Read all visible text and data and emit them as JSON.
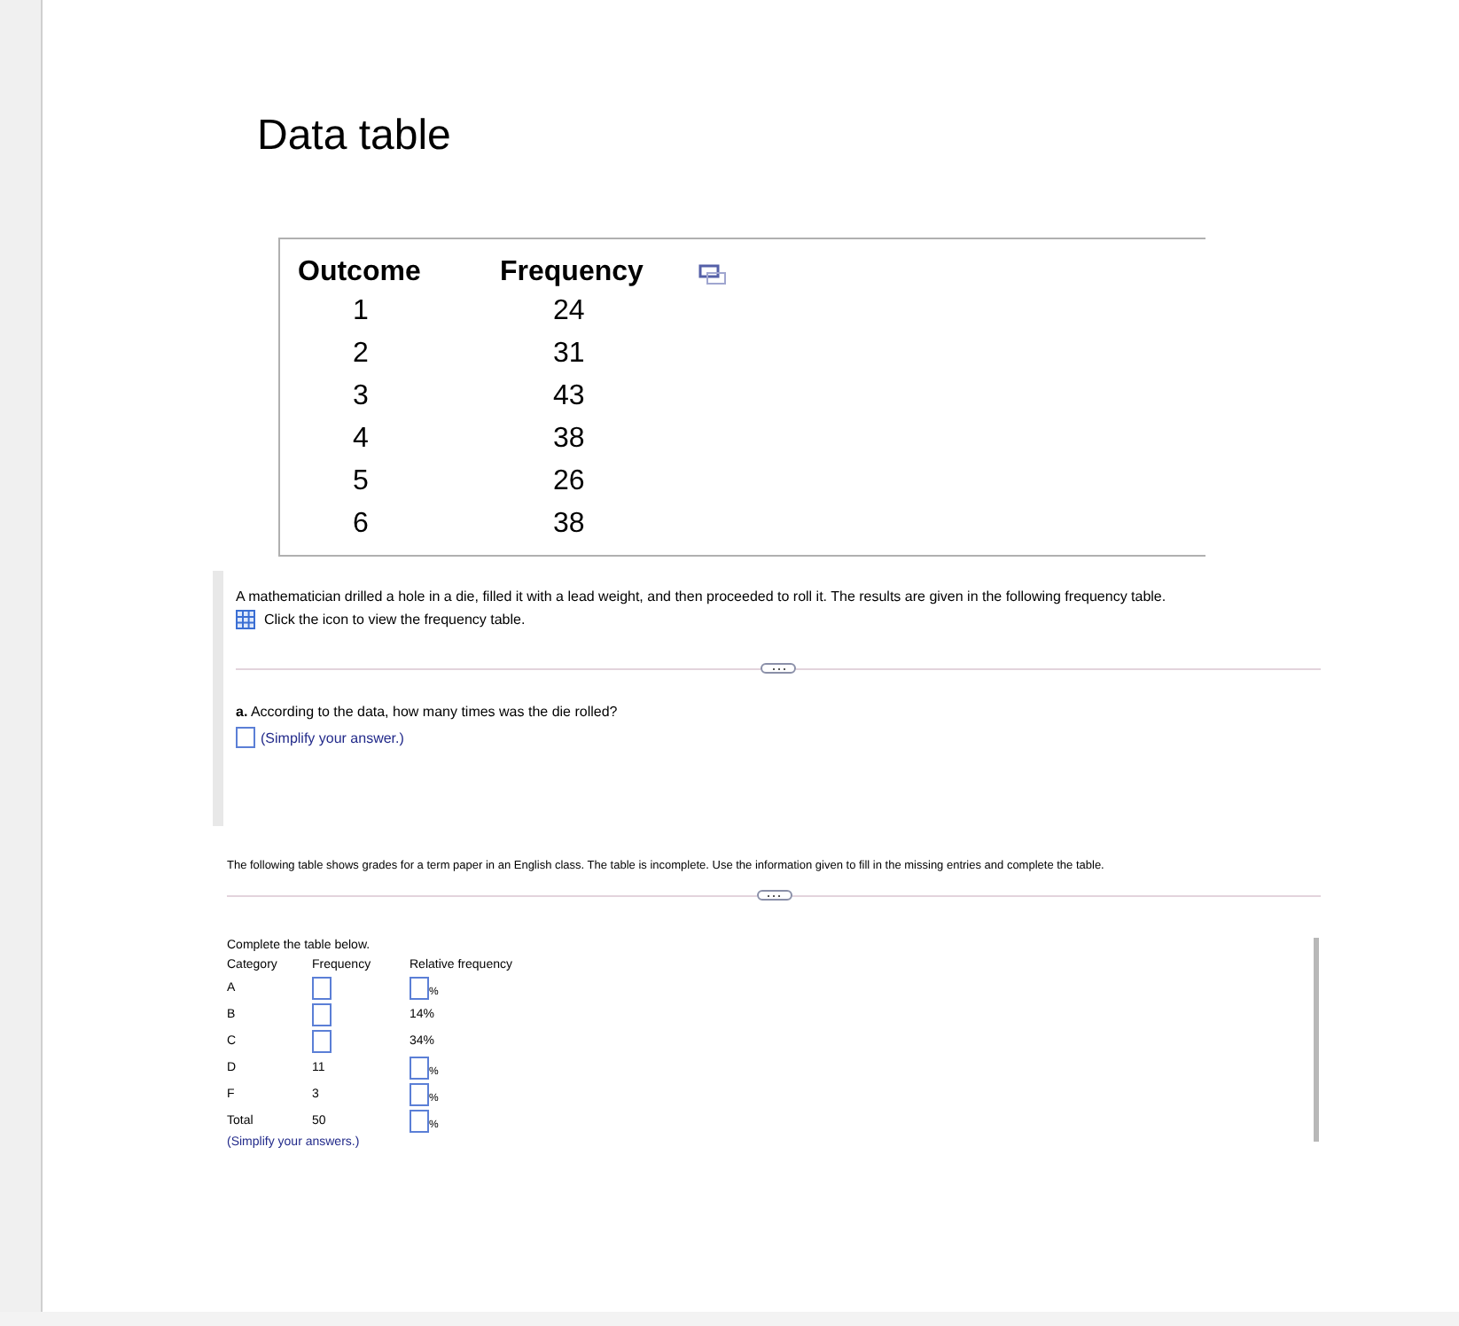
{
  "dialog": {
    "title": "Data table",
    "table": {
      "columns": [
        "Outcome",
        "Frequency"
      ],
      "rows": [
        [
          "1",
          "24"
        ],
        [
          "2",
          "31"
        ],
        [
          "3",
          "43"
        ],
        [
          "4",
          "38"
        ],
        [
          "5",
          "26"
        ],
        [
          "6",
          "38"
        ]
      ]
    }
  },
  "question1": {
    "text": "A mathematician drilled a hole in a die, filled it with a lead weight, and then proceeded to roll it. The results are given in the following frequency table.",
    "icon_link": "Click the icon to view the frequency table.",
    "part_label": "a.",
    "part_text": "According to the data, how many times was the die rolled?",
    "hint": "(Simplify your answer.)"
  },
  "question2": {
    "text": "The following table shows grades for a term paper in an English class. The table is incomplete. Use the information given to fill in the missing entries and complete the table.",
    "instruction": "Complete the table below.",
    "columns": [
      "Category",
      "Frequency",
      "Relative frequency"
    ],
    "rows": [
      {
        "category": "A",
        "frequency": {
          "kind": "input"
        },
        "relative": {
          "kind": "input",
          "suffix": "%"
        }
      },
      {
        "category": "B",
        "frequency": {
          "kind": "input"
        },
        "relative": {
          "kind": "text",
          "text": "14%"
        }
      },
      {
        "category": "C",
        "frequency": {
          "kind": "input"
        },
        "relative": {
          "kind": "text",
          "text": "34%"
        }
      },
      {
        "category": "D",
        "frequency": {
          "kind": "text",
          "text": "11"
        },
        "relative": {
          "kind": "input",
          "suffix": "%"
        }
      },
      {
        "category": "F",
        "frequency": {
          "kind": "text",
          "text": "3"
        },
        "relative": {
          "kind": "input",
          "suffix": "%"
        }
      },
      {
        "category": "Total",
        "frequency": {
          "kind": "text",
          "text": "50"
        },
        "relative": {
          "kind": "input",
          "suffix": "%"
        }
      }
    ],
    "hint": "(Simplify your answers.)"
  }
}
